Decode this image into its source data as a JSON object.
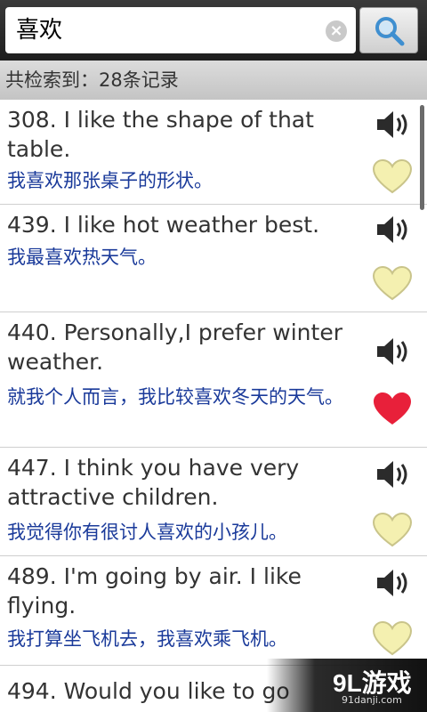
{
  "search": {
    "query": "喜欢",
    "clear_label": "×"
  },
  "summary": {
    "text": "共检索到：28条记录"
  },
  "results": [
    {
      "en": "308. I like the shape of that table.",
      "zh": "我喜欢那张桌子的形状。",
      "favorited": false
    },
    {
      "en": "439. I like hot weather best.",
      "zh": "我最喜欢热天气。",
      "favorited": false
    },
    {
      "en": "440. Personally,I prefer winter weather.",
      "zh": "就我个人而言，我比较喜欢冬天的天气。",
      "favorited": true
    },
    {
      "en": "447. I think you have very attractive children.",
      "zh": "我觉得你有很讨人喜欢的小孩儿。",
      "favorited": false
    },
    {
      "en": "489. I'm going by air. I like flying.",
      "zh": "我打算坐飞机去，我喜欢乘飞机。",
      "favorited": false
    },
    {
      "en": "494. Would you like to go",
      "zh": "",
      "favorited": false
    }
  ],
  "colors": {
    "heart_on": "#e8203a",
    "heart_off": "#f4f0b0",
    "chinese_text": "#1a3a9a"
  },
  "watermark": {
    "logo": "9L游戏",
    "url": "91danji.com"
  }
}
